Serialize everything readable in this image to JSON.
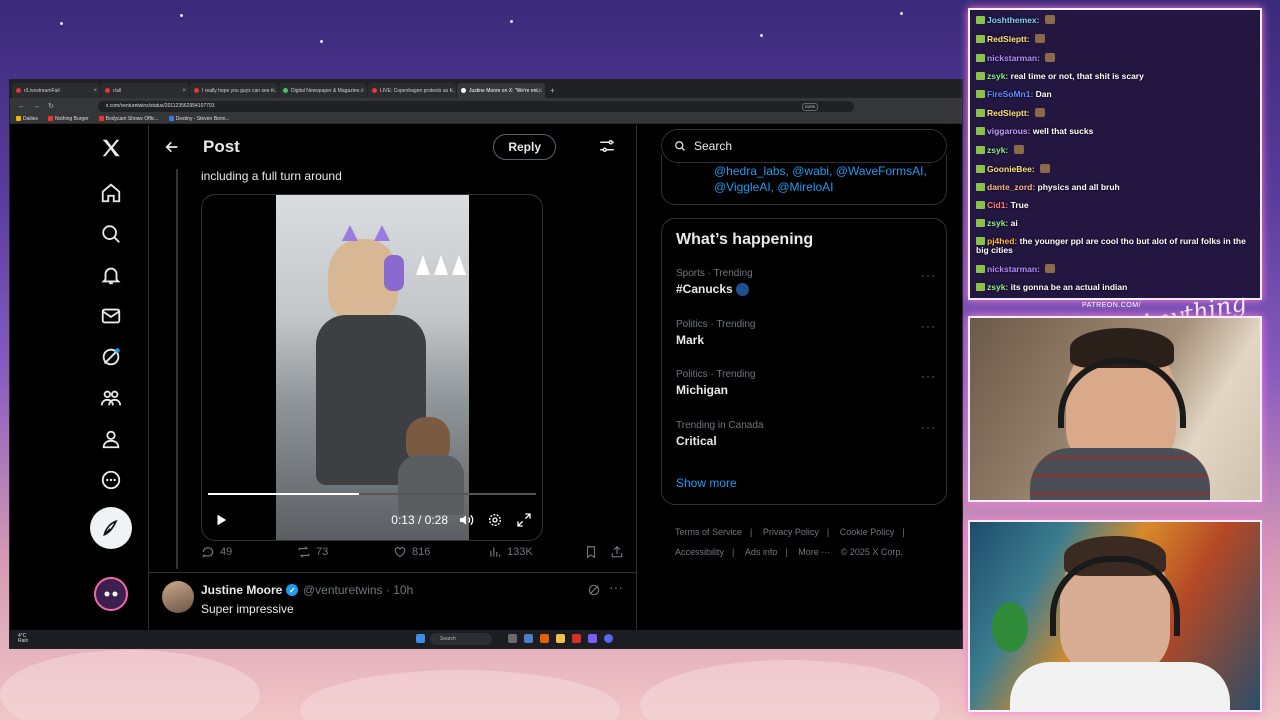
{
  "browser": {
    "tabs": [
      {
        "label": "r/LivestreamFail"
      },
      {
        "label": "r/all"
      },
      {
        "label": "I really hope you guys can see t..."
      },
      {
        "label": "Digital Newspaper & Magazine..."
      },
      {
        "label": "LIVE: Copenhagen protests as I..."
      },
      {
        "label": "Justine Moore on X: \"We're ent..."
      }
    ],
    "new_tab": "+",
    "url": "x.com/venturetwins/status/201123562954107703",
    "zoom": "210%",
    "bookmarks": [
      "Dailies",
      "Nothing Burger",
      "Bodycam Shows Offic...",
      "Destiny - Steven Bonn..."
    ]
  },
  "taskbar": {
    "weather_temp": "4°C",
    "weather_desc": "Rain",
    "search": "Search"
  },
  "post": {
    "header_title": "Post",
    "reply_button": "Reply",
    "tweet_text": "including a full turn around",
    "video": {
      "time": "0:13 / 0:28",
      "progress": 0.46
    },
    "actions": {
      "replies": "49",
      "reposts": "73",
      "likes": "816",
      "views": "133K"
    }
  },
  "reply": {
    "name": "Justine Moore",
    "handle": "@venturetwins · 10h",
    "text": "Super impressive"
  },
  "sidebar": {
    "search_placeholder": "Search",
    "mentions_line1": "@hedra_labs, @wabi, @WaveFormsAI,",
    "mentions_line2": "@ViggleAI, @MireloAI",
    "trends_title": "What’s happening",
    "trends": [
      {
        "meta": "Sports · Trending",
        "name": "#Canucks"
      },
      {
        "meta": "Politics · Trending",
        "name": "Mark"
      },
      {
        "meta": "Politics · Trending",
        "name": "Michigan"
      },
      {
        "meta": "Trending in Canada",
        "name": "Critical"
      }
    ],
    "show_more": "Show more",
    "footer": {
      "terms": "Terms of Service",
      "privacy": "Privacy Policy",
      "cookie": "Cookie Policy",
      "accessibility": "Accessibility",
      "ads": "Ads info",
      "more": "More ···",
      "copyright": "© 2025 X Corp."
    }
  },
  "chat": {
    "messages": [
      {
        "user": "Joshthemex:",
        "text": "",
        "color": "#7fd4ff"
      },
      {
        "user": "RedSleptt:",
        "text": "",
        "color": "#ffe27a"
      },
      {
        "user": "nickstarman:",
        "text": "",
        "color": "#b48cff"
      },
      {
        "user": "zsyk:",
        "text": "real time or not, that shit is scary",
        "color": "#8cf08c"
      },
      {
        "user": "FireSoMn1:",
        "text": "Dan",
        "color": "#5f8cff"
      },
      {
        "user": "RedSleptt:",
        "text": "",
        "color": "#ffe27a"
      },
      {
        "user": "viggarous:",
        "text": "well that sucks",
        "color": "#c89cff"
      },
      {
        "user": "zsyk:",
        "text": "",
        "color": "#8cf08c"
      },
      {
        "user": "GoonieBee:",
        "text": "",
        "color": "#ffe27a"
      },
      {
        "user": "dante_zord:",
        "text": "physics and all bruh",
        "color": "#ffb38a"
      },
      {
        "user": "Cid1:",
        "text": "True",
        "color": "#ff7a7a"
      },
      {
        "user": "zsyk:",
        "text": "ai",
        "color": "#8cf08c"
      },
      {
        "user": "pj4hed:",
        "text": "the younger ppl are cool tho but alot of rural folks in the big cities",
        "color": "#ffb347"
      },
      {
        "user": "nickstarman:",
        "text": "",
        "color": "#b48cff"
      },
      {
        "user": "zsyk:",
        "text": "its gonna be an actual indian",
        "color": "#8cf08c"
      }
    ]
  },
  "overlay": {
    "patreon": "PATREON.COM/",
    "signature": "Anything else?"
  },
  "colors": {
    "x_blue": "#1d9bf0",
    "x_bg": "#000000",
    "border": "#2f3336",
    "muted": "#71767b",
    "cam_border_glow": "#ff7ad9"
  },
  "icons": [
    "x-logo-icon",
    "home-icon",
    "search-icon",
    "bell-icon",
    "mail-icon",
    "grok-icon",
    "communities-icon",
    "profile-icon",
    "more-icon",
    "compose-icon",
    "back-arrow-icon",
    "tune-icon",
    "play-icon",
    "volume-icon",
    "settings-icon",
    "fullscreen-icon",
    "reply-icon",
    "repost-icon",
    "like-icon",
    "views-icon",
    "bookmark-icon",
    "share-icon",
    "verified-icon"
  ]
}
